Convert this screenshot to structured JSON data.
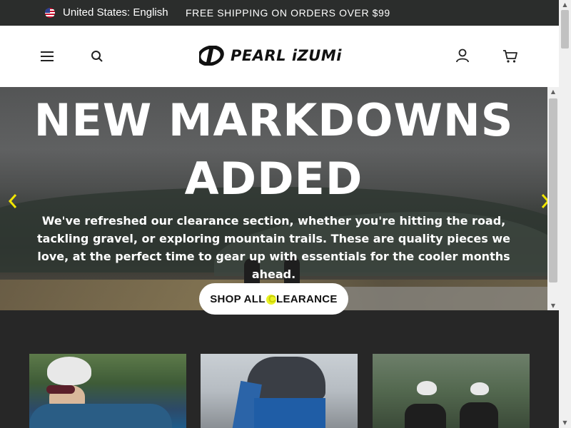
{
  "topbar": {
    "locale_label": "United States: English",
    "promo_text": "FREE SHIPPING ON ORDERS OVER $99"
  },
  "header": {
    "menu_icon": "hamburger-menu-icon",
    "search_icon": "search-icon",
    "logo_text": "PEARL iZUMi",
    "account_icon": "user-account-icon",
    "cart_icon": "shopping-cart-icon"
  },
  "hero": {
    "title_line1": "NEW MARKDOWNS",
    "title_line2": "ADDED",
    "description": "We've refreshed our clearance section, whether you're hitting the road, tackling gravel, or exploring mountain trails. These are quality pieces we love, at the perfect time to gear up with essentials for the cooler months ahead.",
    "cta_label": "SHOP ALL CLEARANCE",
    "prev_arrow": "‹",
    "next_arrow": "›"
  },
  "colors": {
    "topbar_bg": "#2b2d2c",
    "arrow_accent": "#f2e600",
    "dark_section_bg": "#272727"
  }
}
